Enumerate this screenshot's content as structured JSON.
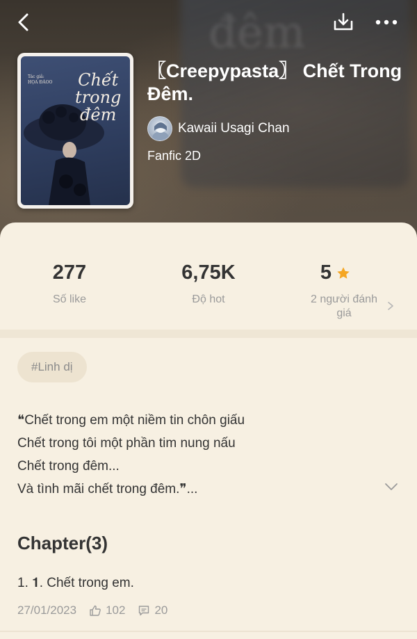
{
  "header": {
    "back_icon": "chevron-left-icon",
    "download_icon": "download-icon",
    "more_icon": "more-horizontal-icon"
  },
  "book": {
    "title": "〖Creepypasta〗 Chết Trong Đêm.",
    "author": "Kawaii Usagi Chan",
    "genre": "Fanfic 2D",
    "cover": {
      "author_caption": "Tác giả:",
      "author_name": "HỌA ĐÀOO",
      "title_line1": "Chết",
      "title_line2": "trong",
      "title_line3": "đêm"
    }
  },
  "stats": [
    {
      "value": "277",
      "label": "Số like"
    },
    {
      "value": "6,75K",
      "label": "Độ hot"
    },
    {
      "value": "5",
      "label": "2 người đánh giá",
      "icon": "star-icon"
    }
  ],
  "tags": [
    "#Linh dị"
  ],
  "description": [
    "❝Chết trong em một niềm tin chôn giấu",
    "Chết trong tôi một phần tim nung nấu",
    "Chết trong đêm...",
    "Và tình mãi chết trong đêm.❞..."
  ],
  "chapters": {
    "heading": "Chapter(3)",
    "items": [
      {
        "title": "1. 𝟏. Chết trong em.",
        "date": "27/01/2023",
        "likes": "102",
        "comments": "20"
      }
    ]
  },
  "colors": {
    "sheet_bg": "#f7f0e2",
    "accent_star": "#f5a623",
    "muted_text": "#9a9a9a"
  }
}
